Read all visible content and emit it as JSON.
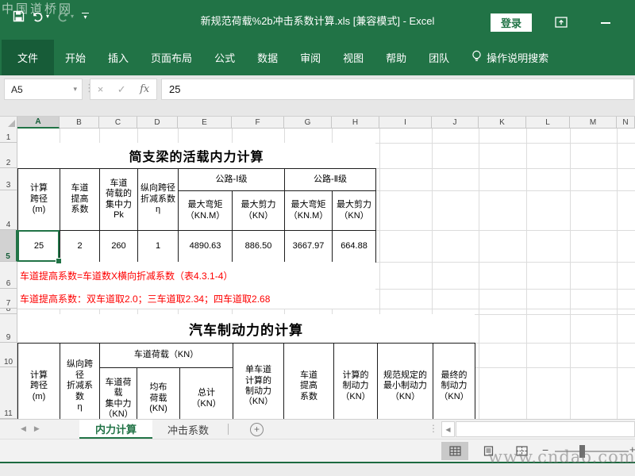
{
  "window": {
    "title": "新规范荷载%2b冲击系数计算.xls  [兼容模式] - Excel",
    "login_label": "登录",
    "watermark_top": "中国道桥网",
    "watermark_bottom": "www.cndao.com"
  },
  "ribbon": {
    "tabs": [
      "文件",
      "开始",
      "插入",
      "页面布局",
      "公式",
      "数据",
      "审阅",
      "视图",
      "帮助",
      "团队"
    ],
    "search_label": "操作说明搜索"
  },
  "formula_bar": {
    "name_box": "A5",
    "cancel_glyph": "×",
    "enter_glyph": "✓",
    "fx_label": "fx",
    "value": "25"
  },
  "grid": {
    "columns": [
      "A",
      "B",
      "C",
      "D",
      "E",
      "F",
      "G",
      "H",
      "I",
      "J",
      "K",
      "L",
      "M",
      "N"
    ],
    "rows": [
      "1",
      "2",
      "3",
      "4",
      "5",
      "6",
      "7",
      "8",
      "9",
      "10",
      "11"
    ]
  },
  "table1": {
    "title": "简支梁的活载内力计算",
    "headers": {
      "span": "计算\n跨径\n(m)",
      "lane_factor": "车道\n提高\n系数",
      "pk": "车道\n荷载的\n集中力\nPk",
      "eta": "纵向跨径\n折减系数\nη",
      "highway1": "公路-Ⅰ级",
      "highway2": "公路-Ⅱ级",
      "mmax1": "最大弯矩\n（KN.M）",
      "vmax1": "最大剪力\n（KN）",
      "mmax2": "最大弯矩\n（KN.M）",
      "vmax2": "最大剪力\n（KN）"
    },
    "values": {
      "span": "25",
      "lane_factor": "2",
      "pk": "260",
      "eta": "1",
      "mmax1": "4890.63",
      "vmax1": "886.50",
      "mmax2": "3667.97",
      "vmax2": "664.88"
    },
    "note1": "车道提高系数=车道数X横向折减系数（表4.3.1-4）",
    "note2": "车道提高系数：双车道取2.0；三车道取2.34；四车道取2.68"
  },
  "table2": {
    "title": "汽车制动力的计算",
    "headers": {
      "span": "计算\n跨径\n(m)",
      "eta": "纵向跨\n径\n折减系\n数\nη",
      "lane_load": "车道荷载（KN）",
      "pk": "车道荷\n载\n集中力\n（KN）",
      "q": "均布\n荷载\n(KN)",
      "total": "总计\n（KN）",
      "single_brake": "单车道\n计算的\n制动力\n（KN）",
      "lane_factor": "车道\n提高\n系数",
      "calc_brake": "计算的\n制动力\n（KN）",
      "min_brake": "规范规定的\n最小制动力\n（KN）",
      "final_brake": "最终的\n制动力\n（KN）"
    }
  },
  "sheet_bar": {
    "active_tab": "内力计算",
    "inactive_tab": "冲击系数",
    "add_glyph": "+"
  },
  "status_bar": {
    "zoom_out_glyph": "−",
    "zoom_in_glyph": "+"
  },
  "colors": {
    "accent_green": "#217346",
    "value_blue": "#0000fe",
    "value_red": "#fe0000"
  }
}
